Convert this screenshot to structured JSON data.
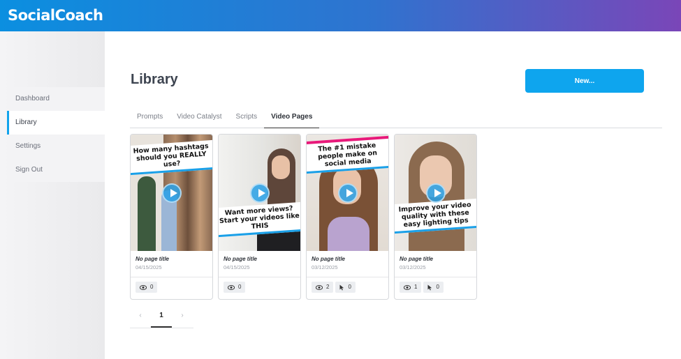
{
  "app": {
    "logo_text": "SocialCoach"
  },
  "sidebar": {
    "items": [
      {
        "label": "Dashboard"
      },
      {
        "label": "Library"
      },
      {
        "label": "Settings"
      },
      {
        "label": "Sign Out"
      }
    ]
  },
  "main": {
    "title": "Library",
    "new_button_label": "New...",
    "tabs": [
      {
        "label": "Prompts"
      },
      {
        "label": "Video Catalyst"
      },
      {
        "label": "Scripts"
      },
      {
        "label": "Video Pages"
      }
    ],
    "cards": [
      {
        "banner_text": "How many hashtags should you REALLY use?",
        "title": "No page title",
        "date": "04/15/2025",
        "views": "0"
      },
      {
        "banner_text": "Want more views? Start your videos like THIS",
        "title": "No page title",
        "date": "04/15/2025",
        "views": "0"
      },
      {
        "banner_text": "The #1 mistake people make on social media",
        "title": "No page title",
        "date": "03/12/2025",
        "views": "2",
        "clicks": "0"
      },
      {
        "banner_text": "Improve your video quality with these easy lighting tips",
        "title": "No page title",
        "date": "03/12/2025",
        "views": "1",
        "clicks": "0"
      }
    ]
  },
  "pagination": {
    "prev": "‹",
    "current": "1",
    "next": "›"
  },
  "colors": {
    "accent": "#0ea5ee",
    "header_start": "#0b8fe0",
    "header_end": "#7a46b8",
    "banner_pink": "#e8197a"
  }
}
